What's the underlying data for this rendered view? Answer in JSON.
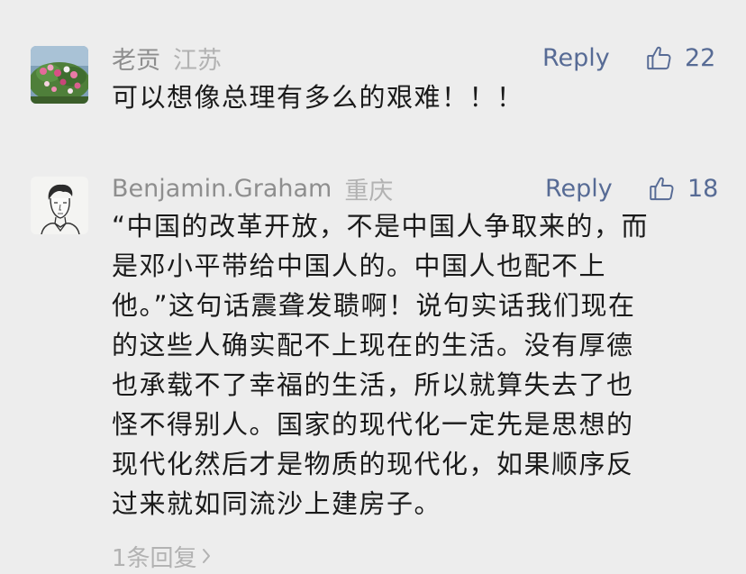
{
  "comments": [
    {
      "author": "老贡",
      "location": "江苏",
      "reply_label": "Reply",
      "like_count": "22",
      "text": "可以想像总理有多么的艰难！！！",
      "avatar_icon": "flower-garden-avatar"
    },
    {
      "author": "Benjamin.Graham",
      "location": "重庆",
      "reply_label": "Reply",
      "like_count": "18",
      "text": "“中国的改革开放，不是中国人争取来的，而\n是邓小平带给中国人的。中国人也配不上\n他。”这句话震聋发聩啊！说句实话我们现在\n的这些人确实配不上现在的生活。没有厚德\n也承载不了幸福的生活，所以就算失去了也\n怪不得别人。国家的现代化一定先是思想的\n现代化然后才是物质的现代化，如果顺序反\n过来就如同流沙上建房子。",
      "avatar_icon": "sketch-man-avatar",
      "sub_replies_label": "1条回复",
      "sub_replies_icon": "chevron-right-icon"
    }
  ],
  "colors": {
    "background": "#ededed",
    "name": "#8e8e8e",
    "location": "#b2b2b2",
    "link": "#576b95",
    "text": "#1a1a1a"
  }
}
